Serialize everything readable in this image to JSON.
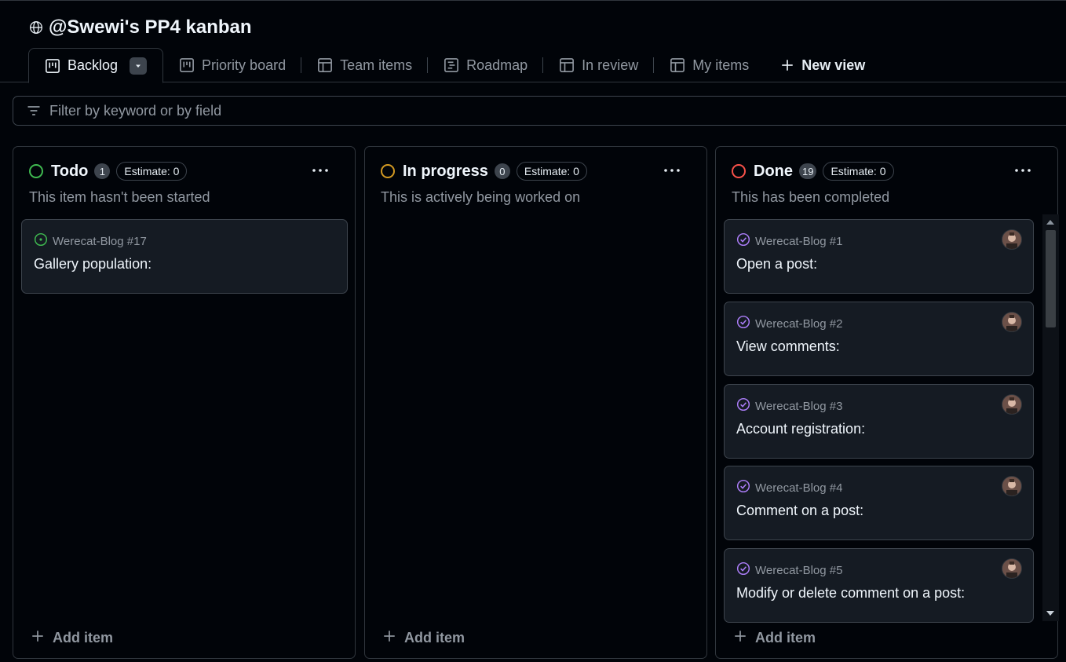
{
  "project": {
    "title": "@Swewi's PP4 kanban"
  },
  "tabs": [
    {
      "label": "Backlog",
      "icon": "board-icon"
    },
    {
      "label": "Priority board",
      "icon": "board-icon"
    },
    {
      "label": "Team items",
      "icon": "table-icon"
    },
    {
      "label": "Roadmap",
      "icon": "roadmap-icon"
    },
    {
      "label": "In review",
      "icon": "table-icon"
    },
    {
      "label": "My items",
      "icon": "table-icon"
    },
    {
      "label": "New view",
      "icon": "plus-icon"
    }
  ],
  "filter": {
    "placeholder": "Filter by keyword or by field"
  },
  "colors": {
    "todo": "#3fb950",
    "in_progress": "#d29922",
    "done": "#f85149",
    "open_issue": "#3fb950",
    "closed_issue": "#ab7df8"
  },
  "columns": [
    {
      "name": "Todo",
      "count": "1",
      "estimate": "Estimate: 0",
      "description": "This item hasn't been started",
      "add_label": "Add item",
      "cards": [
        {
          "ref": "Werecat-Blog #17",
          "title": "Gallery population:",
          "state": "open"
        }
      ]
    },
    {
      "name": "In progress",
      "count": "0",
      "estimate": "Estimate: 0",
      "description": "This is actively being worked on",
      "add_label": "Add item",
      "cards": []
    },
    {
      "name": "Done",
      "count": "19",
      "estimate": "Estimate: 0",
      "description": "This has been completed",
      "add_label": "Add item",
      "cards": [
        {
          "ref": "Werecat-Blog #1",
          "title": "Open a post:",
          "state": "closed"
        },
        {
          "ref": "Werecat-Blog #2",
          "title": "View comments:",
          "state": "closed"
        },
        {
          "ref": "Werecat-Blog #3",
          "title": "Account registration:",
          "state": "closed"
        },
        {
          "ref": "Werecat-Blog #4",
          "title": "Comment on a post:",
          "state": "closed"
        },
        {
          "ref": "Werecat-Blog #5",
          "title": "Modify or delete comment on a post:",
          "state": "closed"
        }
      ]
    }
  ]
}
